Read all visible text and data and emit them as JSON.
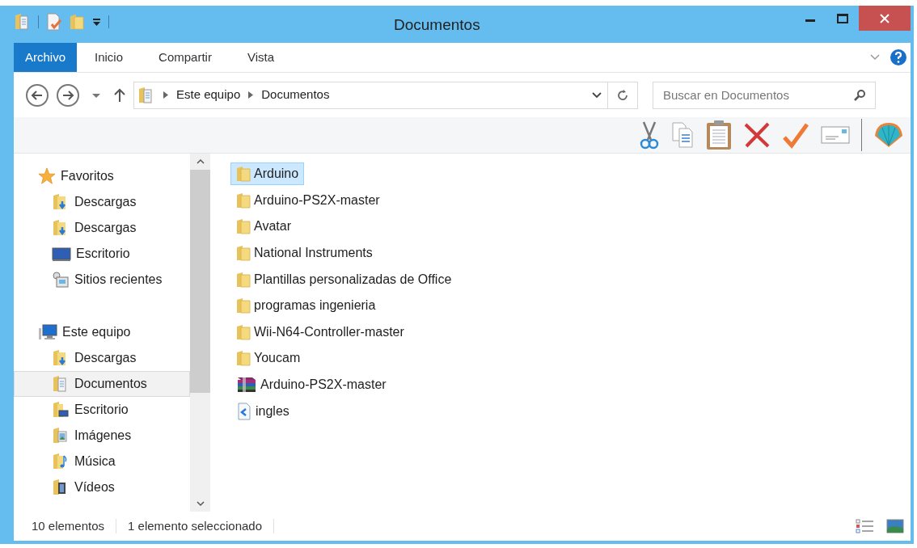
{
  "window": {
    "title": "Documentos"
  },
  "ribbon_tabs": [
    {
      "label": "Archivo",
      "selected": true
    },
    {
      "label": "Inicio",
      "selected": false
    },
    {
      "label": "Compartir",
      "selected": false
    },
    {
      "label": "Vista",
      "selected": false
    }
  ],
  "address_bar": {
    "path": [
      "Este equipo",
      "Documentos"
    ]
  },
  "search": {
    "placeholder": "Buscar en Documentos"
  },
  "sidebar": {
    "groups": [
      {
        "label": "Favoritos",
        "children": [
          {
            "label": "Descargas",
            "selected": false
          },
          {
            "label": "Descargas",
            "selected": false
          },
          {
            "label": "Escritorio",
            "selected": false
          },
          {
            "label": "Sitios recientes",
            "selected": false
          }
        ]
      },
      {
        "label": "Este equipo",
        "children": [
          {
            "label": "Descargas",
            "selected": false
          },
          {
            "label": "Documentos",
            "selected": true
          },
          {
            "label": "Escritorio",
            "selected": false
          },
          {
            "label": "Imágenes",
            "selected": false
          },
          {
            "label": "Música",
            "selected": false
          },
          {
            "label": "Vídeos",
            "selected": false
          }
        ]
      }
    ]
  },
  "files": [
    {
      "name": "Arduino",
      "kind": "folder",
      "selected": true
    },
    {
      "name": "Arduino-PS2X-master",
      "kind": "folder",
      "selected": false
    },
    {
      "name": "Avatar",
      "kind": "folder",
      "selected": false
    },
    {
      "name": "National Instruments",
      "kind": "folder",
      "selected": false
    },
    {
      "name": "Plantillas personalizadas de Office",
      "kind": "folder",
      "selected": false
    },
    {
      "name": "programas ingenieria",
      "kind": "folder",
      "selected": false
    },
    {
      "name": "Wii-N64-Controller-master",
      "kind": "folder",
      "selected": false
    },
    {
      "name": "Youcam",
      "kind": "folder",
      "selected": false
    },
    {
      "name": "Arduino-PS2X-master",
      "kind": "archive",
      "selected": false
    },
    {
      "name": "ingles",
      "kind": "document",
      "selected": false
    }
  ],
  "status_bar": {
    "count": "10 elementos",
    "selection": "1 elemento seleccionado"
  }
}
